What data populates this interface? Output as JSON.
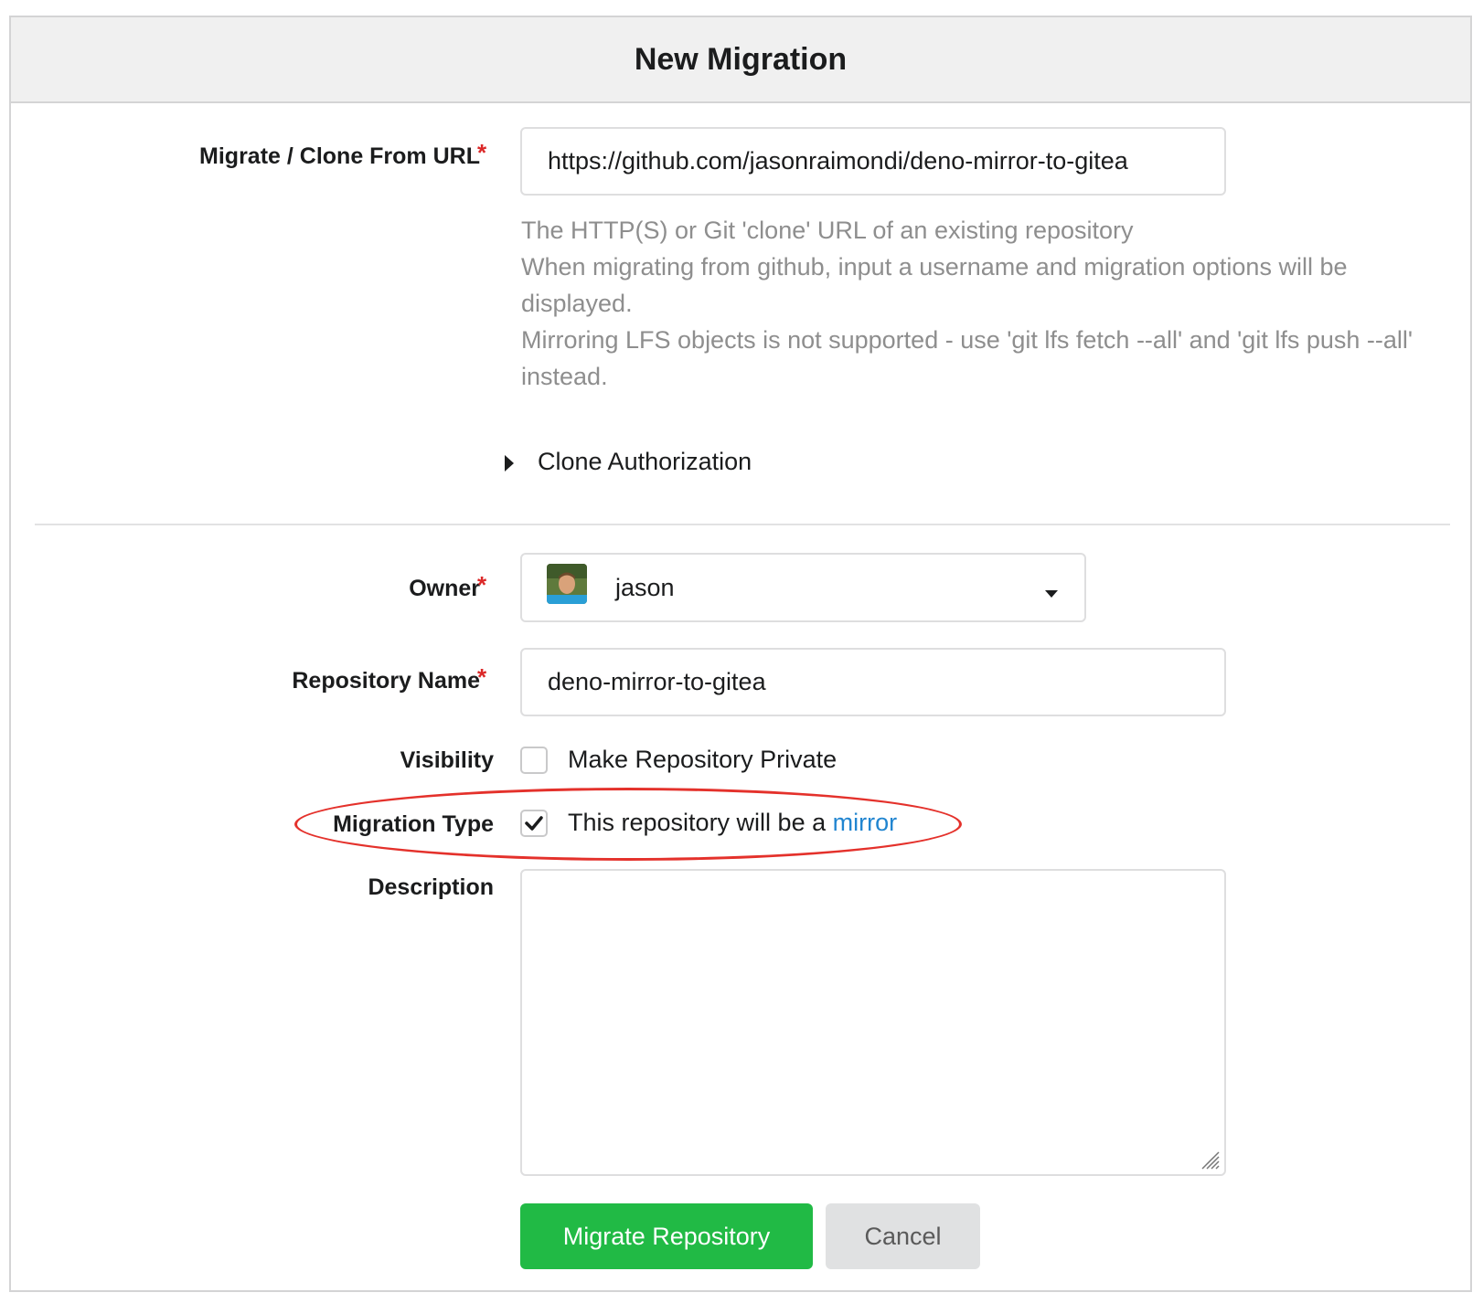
{
  "header": {
    "title": "New Migration"
  },
  "url_field": {
    "label": "Migrate / Clone From URL",
    "required_mark": "*",
    "value": "https://github.com/jasonraimondi/deno-mirror-to-gitea",
    "help_lines": [
      "The HTTP(S) or Git 'clone' URL of an existing repository",
      "When migrating from github, input a username and migration options will be displayed.",
      "Mirroring LFS objects is not supported - use 'git lfs fetch --all' and 'git lfs push --all' instead."
    ]
  },
  "clone_auth": {
    "label": "Clone Authorization",
    "icon": "triangle-right-icon"
  },
  "owner": {
    "label": "Owner",
    "required_mark": "*",
    "value": "jason",
    "icon": "chevron-down-icon"
  },
  "repo_name": {
    "label": "Repository Name",
    "required_mark": "*",
    "value": "deno-mirror-to-gitea"
  },
  "visibility": {
    "label": "Visibility",
    "checkbox_label": "Make Repository Private",
    "checked": false
  },
  "migration_type": {
    "label": "Migration Type",
    "checkbox_label_prefix": "This repository will be a",
    "link_text": "mirror",
    "checked": true,
    "highlight_color": "#e4312b"
  },
  "description": {
    "label": "Description",
    "value": ""
  },
  "buttons": {
    "submit": "Migrate Repository",
    "cancel": "Cancel"
  },
  "colors": {
    "primary": "#21ba45",
    "required": "#db2828",
    "link": "#2185d0"
  }
}
